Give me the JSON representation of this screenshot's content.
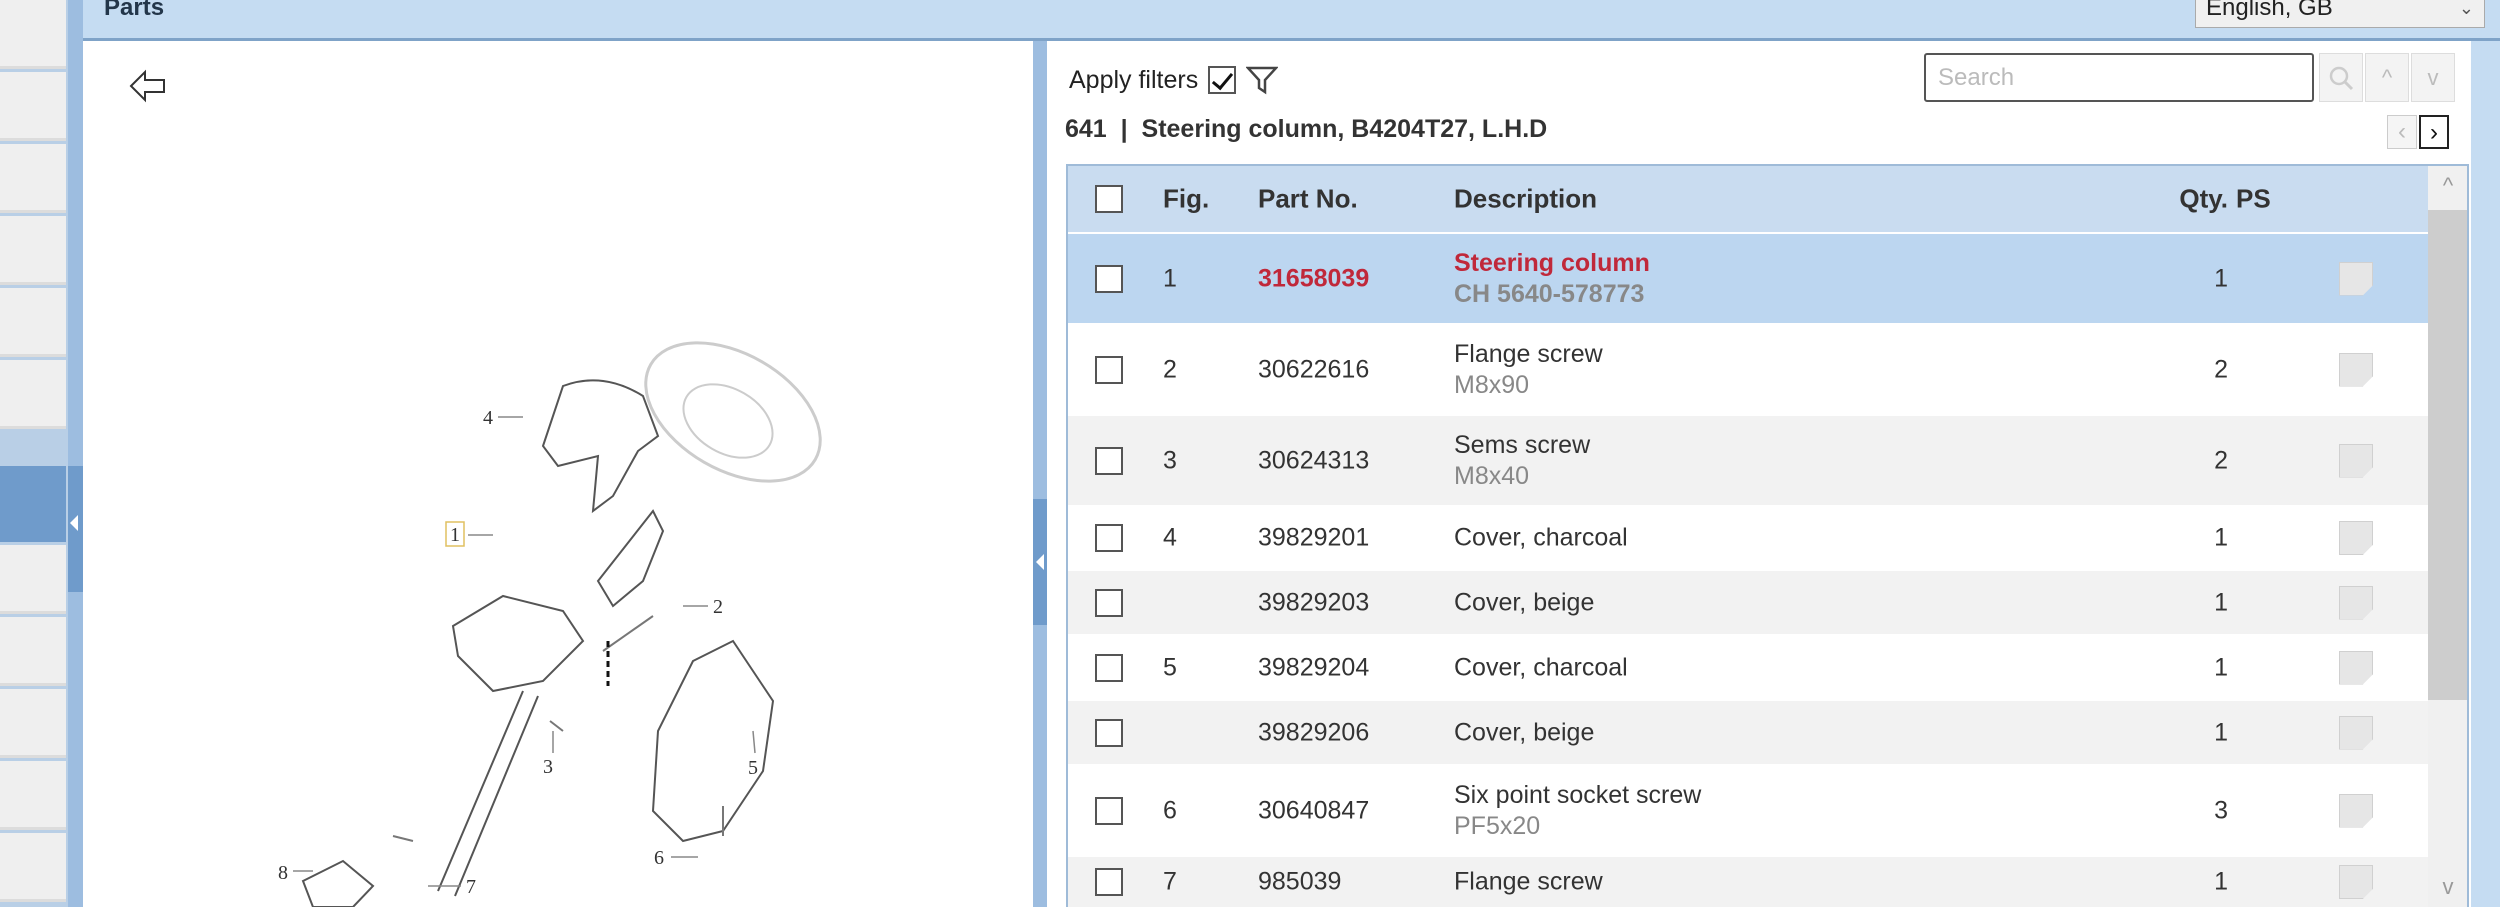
{
  "header": {
    "title": "Parts",
    "language": "English, GB"
  },
  "filters": {
    "label": "Apply filters",
    "checked": true
  },
  "search": {
    "placeholder": "Search",
    "up": "^",
    "down": "v"
  },
  "breadcrumb": {
    "number": "641",
    "separator": "|",
    "title": "Steering column, B4204T27, L.H.D"
  },
  "pager": {
    "prev": "‹",
    "next": "›"
  },
  "table": {
    "columns": {
      "fig": "Fig.",
      "part": "Part No.",
      "desc": "Description",
      "qty": "Qty.",
      "ps": "PS"
    },
    "rows": [
      {
        "fig": "1",
        "part": "31658039",
        "desc": "Steering column",
        "sub": "CH 5640-578773",
        "qty": "1",
        "selected": true
      },
      {
        "fig": "2",
        "part": "30622616",
        "desc": "Flange screw",
        "sub": "M8x90",
        "qty": "2"
      },
      {
        "fig": "3",
        "part": "30624313",
        "desc": "Sems screw",
        "sub": "M8x40",
        "qty": "2"
      },
      {
        "fig": "4",
        "part": "39829201",
        "desc": "Cover, charcoal",
        "sub": "",
        "qty": "1"
      },
      {
        "fig": "",
        "part": "39829203",
        "desc": "Cover, beige",
        "sub": "",
        "qty": "1"
      },
      {
        "fig": "5",
        "part": "39829204",
        "desc": "Cover, charcoal",
        "sub": "",
        "qty": "1"
      },
      {
        "fig": "",
        "part": "39829206",
        "desc": "Cover, beige",
        "sub": "",
        "qty": "1"
      },
      {
        "fig": "6",
        "part": "30640847",
        "desc": "Six point socket screw",
        "sub": "PF5x20",
        "qty": "3"
      },
      {
        "fig": "7",
        "part": "985039",
        "desc": "Flange screw",
        "sub": "",
        "qty": "1"
      }
    ]
  },
  "diagram": {
    "callouts": [
      "1",
      "2",
      "3",
      "4",
      "5",
      "6",
      "7",
      "8"
    ]
  },
  "colors": {
    "accent": "#c5dcf2",
    "selected_row": "#bcd6f0",
    "part_highlight": "#c0283a"
  }
}
